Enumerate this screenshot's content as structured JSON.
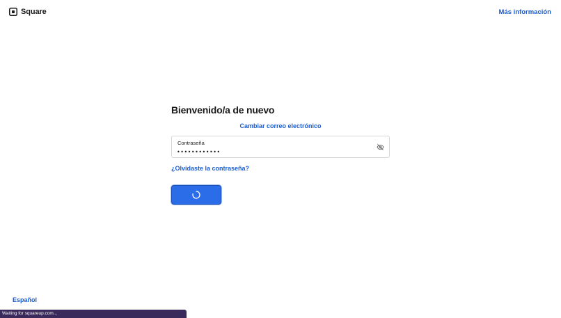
{
  "header": {
    "logo_text": "Square",
    "more_info_link": "Más información"
  },
  "form": {
    "title": "Bienvenido/a de nuevo",
    "change_email_link": "Cambiar correo electrónico",
    "password_label": "Contraseña",
    "password_value": "••••••••••••",
    "toggle_icon": "eye-slash-icon",
    "forgot_link": "¿Olvidaste la contraseña?",
    "submit_state": "loading",
    "submit_icon": "spinner-icon"
  },
  "footer": {
    "language_link": "Español",
    "status_text": "Waiting for squareup.com..."
  },
  "colors": {
    "link": "#1a5ccf",
    "button": "#2b6de8",
    "status_bar": "#3a2a5c"
  }
}
